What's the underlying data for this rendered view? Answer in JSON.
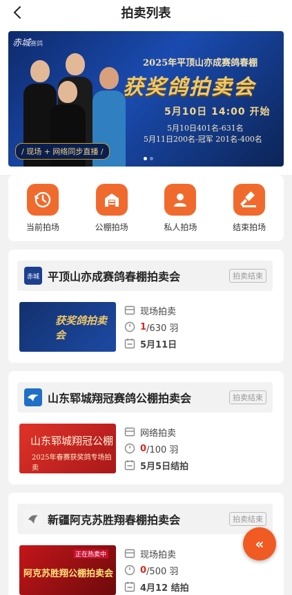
{
  "nav": {
    "title": "拍卖列表"
  },
  "banner": {
    "brand": "赤城",
    "brand_sub": "赛鸽",
    "subtitle": "2025年平顶山亦成赛鸽春棚",
    "title": "获奖鸽拍卖会",
    "time": "5月10日 14:00 开始",
    "line1": "5月10日401名-631名",
    "line2": "5月11日200名-冠军 201名-400名",
    "live": "/ 现场 + 网络同步直播 /"
  },
  "categories": [
    {
      "label": "当前拍场",
      "icon": "history-clock-icon"
    },
    {
      "label": "公棚拍场",
      "icon": "building-icon"
    },
    {
      "label": "私人拍场",
      "icon": "person-icon"
    },
    {
      "label": "结束拍场",
      "icon": "gavel-icon"
    }
  ],
  "auctions": [
    {
      "name": "平顶山亦成赛鸽春棚拍卖会",
      "status": "拍卖结束",
      "type": "现场拍卖",
      "sold": "1",
      "count_rest": "/630 羽",
      "date": "5月11日",
      "thumb": {
        "line1": "获奖鸽拍卖会"
      }
    },
    {
      "name": "山东郓城翔冠赛鸽公棚拍卖会",
      "status": "拍卖结束",
      "type": "网络拍卖",
      "sold": "0",
      "count_rest": "/100 羽",
      "date": "5月5日结拍",
      "thumb": {
        "line1": "山东郓城翔冠公棚",
        "line2": "2025年春赛获奖鸽专场拍卖"
      }
    },
    {
      "name": "新疆阿克苏胜翔春棚拍卖会",
      "status": "拍卖结束",
      "type": "现场拍卖",
      "sold": "0",
      "count_rest": "/500 羽",
      "date": "4月12 结拍",
      "thumb": {
        "tag": "正在热卖中",
        "line1": "阿克苏胜翔公棚拍卖会"
      }
    }
  ],
  "fab": {
    "label": "«"
  },
  "colors": {
    "accent": "#f16a2d",
    "sold": "#d9281f",
    "fab": "#f15a22"
  }
}
